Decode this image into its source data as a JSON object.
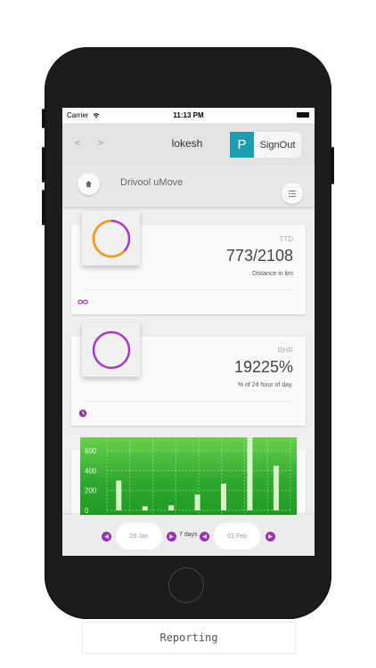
{
  "status_bar": {
    "carrier": "Carrier",
    "time": "11:13 PM"
  },
  "nav": {
    "arrows": "< >",
    "title": "lokesh",
    "badge": "P",
    "signout": "SignOut"
  },
  "header": {
    "app_name": "Drivool uMove"
  },
  "cards": [
    {
      "label": "TTD",
      "value": "773/2108",
      "sub": "Distance in km",
      "progress": 0.37,
      "ring_color": "#a43bc0",
      "arc_color": "#f39c12"
    },
    {
      "label": "RHR",
      "value": "19225%",
      "sub": "% of 24 hour of day.",
      "progress": 1.0,
      "ring_color": "#a43bc0"
    }
  ],
  "chart_data": {
    "type": "bar",
    "yticks": [
      "600",
      "400",
      "200",
      "0"
    ],
    "values": [
      300,
      40,
      50,
      160,
      270,
      740,
      450
    ],
    "ylim": [
      0,
      700
    ],
    "bar_color": "#d8f3c8",
    "background": "#3fb33a"
  },
  "footer": {
    "start_date": "28 Jan",
    "range": "7 days",
    "end_date": "03 Feb"
  },
  "caption": "Reporting",
  "colors": {
    "accent": "#9b30b8",
    "badge": "#1e9db0"
  }
}
